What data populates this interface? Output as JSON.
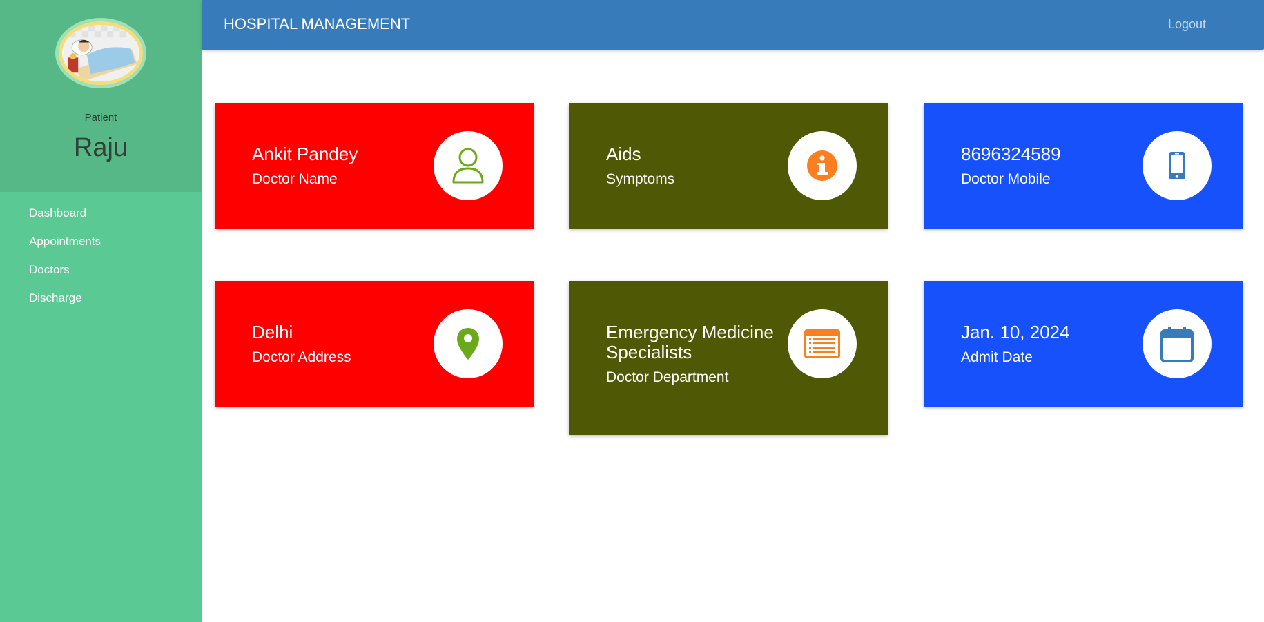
{
  "app": {
    "title": "HOSPITAL MANAGEMENT",
    "logout_label": "Logout"
  },
  "sidebar": {
    "role": "Patient",
    "username": "Raju",
    "items": [
      {
        "label": "Dashboard"
      },
      {
        "label": "Appointments"
      },
      {
        "label": "Doctors"
      },
      {
        "label": "Discharge"
      }
    ]
  },
  "cards": [
    {
      "value": "Ankit Pandey",
      "label": "Doctor Name",
      "icon": "user-icon",
      "color": "#ff0000",
      "icon_color": "#6aaa1a"
    },
    {
      "value": "Aids",
      "label": "Symptoms",
      "icon": "info-icon",
      "color": "#4f5805",
      "icon_color": "#fb7e20"
    },
    {
      "value": "8696324589",
      "label": "Doctor Mobile",
      "icon": "mobile-icon",
      "color": "#1651fc",
      "icon_color": "#377bbb"
    },
    {
      "value": "Delhi",
      "label": "Doctor Address",
      "icon": "map-marker-icon",
      "color": "#ff0000",
      "icon_color": "#6aaa1a"
    },
    {
      "value": "Emergency Medicine Specialists",
      "label": "Doctor Department",
      "icon": "list-icon",
      "color": "#4f5805",
      "icon_color": "#fb7e20"
    },
    {
      "value": "Jan. 10, 2024",
      "label": "Admit Date",
      "icon": "calendar-icon",
      "color": "#1651fc",
      "icon_color": "#377bbb"
    }
  ]
}
